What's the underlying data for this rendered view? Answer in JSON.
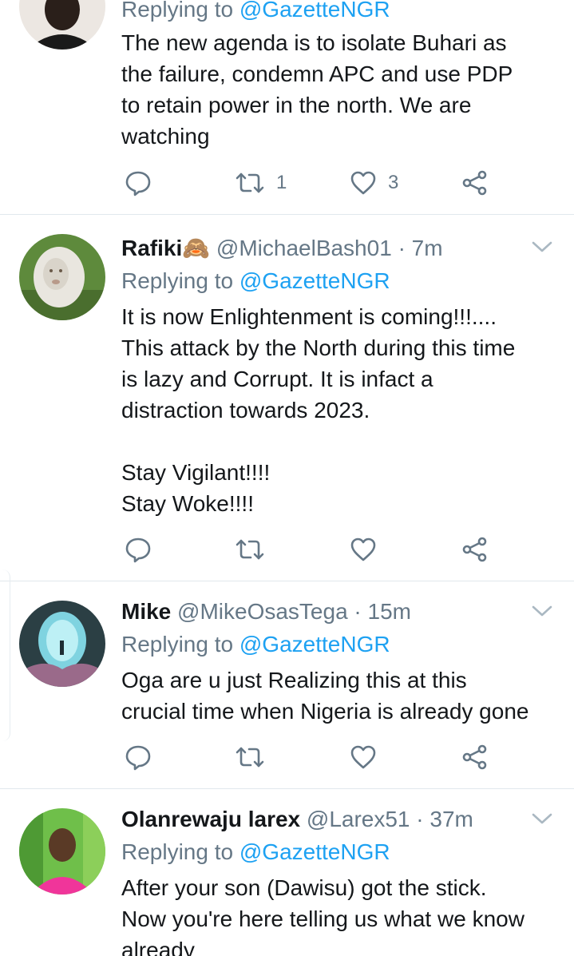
{
  "tweets": [
    {
      "reply_prefix": "Replying to",
      "reply_to": "@GazetteNGR",
      "lines": [
        "The new agenda is to isolate Buhari as",
        "the failure, condemn APC and use PDP",
        "to retain power in the north. We are",
        "watching"
      ],
      "retweets": "1",
      "likes": "3"
    },
    {
      "name": "Rafiki🙈",
      "handle": "@MichaelBash01",
      "separator": "·",
      "time": "7m",
      "reply_prefix": "Replying to",
      "reply_to": "@GazetteNGR",
      "lines": [
        "It is now Enlightenment is coming!!!....",
        "This attack by the North during this time",
        "is lazy and Corrupt. It is infact a",
        "distraction towards 2023.",
        "",
        "Stay Vigilant!!!!",
        "Stay Woke!!!!"
      ]
    },
    {
      "name": "Mike",
      "handle": "@MikeOsasTega",
      "separator": "·",
      "time": "15m",
      "reply_prefix": "Replying to",
      "reply_to": "@GazetteNGR",
      "lines": [
        "Oga are u just Realizing this at this",
        "crucial time when Nigeria is already gone"
      ]
    },
    {
      "name": "Olanrewaju larex",
      "handle": "@Larex51",
      "separator": "·",
      "time": "37m",
      "reply_prefix": "Replying to",
      "reply_to": "@GazetteNGR",
      "lines": [
        "After your son (Dawisu) got the stick.",
        "Now you're here telling us what we know",
        "already"
      ]
    }
  ],
  "icons": {
    "reply": "reply-icon",
    "retweet": "retweet-icon",
    "like": "heart-icon",
    "share": "share-icon",
    "menu": "chevron-down-icon"
  },
  "colors": {
    "text": "#14171a",
    "muted": "#657786",
    "link": "#1da1f2",
    "divider": "#e1e8ed"
  }
}
